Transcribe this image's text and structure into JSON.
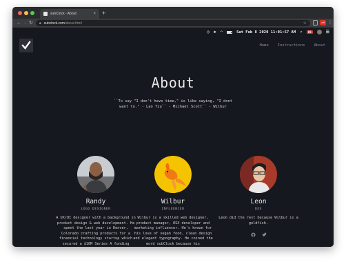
{
  "browser": {
    "tab_title": "subClock - About",
    "tab_close": "×",
    "new_tab": "+",
    "url_host": "subclock.com",
    "url_path": "/about.html",
    "ext_badge": "off"
  },
  "menubar": {
    "datetime": "Sat Feb 8 2020  11:01:57 AM",
    "badge": "88"
  },
  "nav": {
    "items": [
      "Home",
      "Instructions",
      "About"
    ]
  },
  "page": {
    "title": "About",
    "quote": "``To say \"I don't have time,\" is like saying, \"I dont want to.\" - Lao Tzu`` - Michael Scott`` - Wilbur"
  },
  "team": [
    {
      "name": "Randy",
      "role": "LOGO DESIGNER",
      "bio": "A UX/UI designer with a background in product design & web development. He spent the last year in Denver, Colorado crafting products for a financial technology startup which secured a $10M Series A funding round."
    },
    {
      "name": "Wilbur",
      "role": "INFLUENCER",
      "bio": "Wilbur is a skilled web designer, product manager, OSX developer and marketing influencer. He's known for his love of vegan food, clean design and elegant typography. He coined the word subClock because his punctuality."
    },
    {
      "name": "Leon",
      "role": "DEV",
      "bio": "Leon did the rest because Wilbur is a goldfish.",
      "socials": [
        "github-icon",
        "twitter-icon"
      ]
    }
  ],
  "colors": {
    "background": "#16181f",
    "text": "#e6e6e6",
    "nav_text": "#8a8d96",
    "goldfish_bg": "#f5c400"
  }
}
